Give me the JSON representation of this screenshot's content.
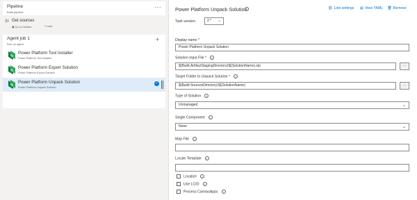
{
  "pipeline": {
    "title": "Pipeline",
    "subtitle": "Build pipeline",
    "more": "···"
  },
  "sources": {
    "title": "Get sources",
    "repo": "Cp-a-Clinician",
    "branch": "main"
  },
  "agent_job": {
    "title": "Agent job 1",
    "subtitle": "Run on agent",
    "add": "+"
  },
  "tasks": [
    {
      "title": "Power Platform Tool Installer",
      "subtitle": "Power Platform Tool Installer"
    },
    {
      "title": "Power Platform Export Solution",
      "subtitle": "Power Platform Export Solution"
    },
    {
      "title": "Power Platform Unpack Solution",
      "subtitle": "Power Platform Unpack Solution"
    }
  ],
  "detail": {
    "title": "Power Platform Unpack Solution",
    "link_settings": "Link settings",
    "view_yaml": "View YAML",
    "remove": "Remove",
    "task_version_label": "Task version",
    "task_version_value": "2.*",
    "display_name_label": "Display name *",
    "display_name_value": "Power Platform Unpack Solution",
    "solution_input_label": "Solution Input File *",
    "solution_input_value": "$(Build.ArtifactStagingDirectory)\\$(SolutionName).zip",
    "target_folder_label": "Target Folder to Unpack Solution *",
    "target_folder_value": "$(Build.SourcesDirectory)\\$(SolutionName)",
    "solution_type_label": "Type of Solution",
    "solution_type_value": "Unmanaged",
    "single_component_label": "Single Component",
    "single_component_value": "None",
    "map_file_label": "Map File",
    "map_file_value": "",
    "locale_template_label": "Locale Template",
    "locale_template_value": "",
    "more_btn": "···",
    "checkboxes": [
      {
        "label": "Localize"
      },
      {
        "label": "Use LCID"
      },
      {
        "label": "Process CanvasApps"
      }
    ]
  },
  "colors": {
    "accent": "#0078d4",
    "selected_bg": "#deecf9",
    "page_bg": "#f3f2f1"
  }
}
